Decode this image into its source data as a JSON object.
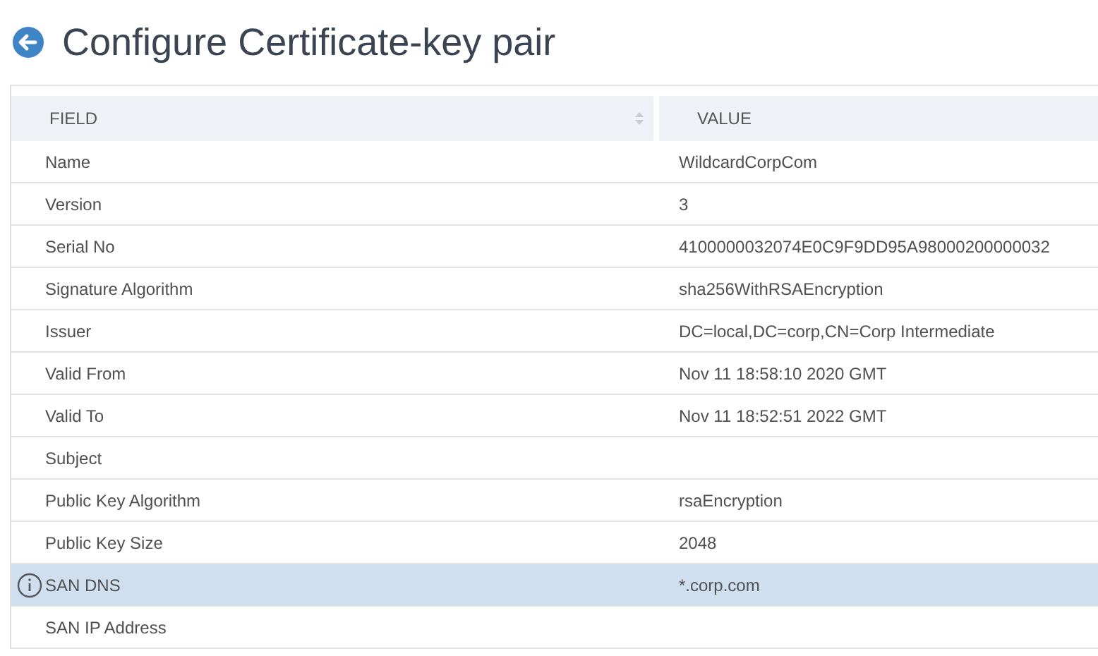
{
  "page": {
    "title": "Configure Certificate-key pair"
  },
  "table": {
    "columns": [
      {
        "label": "FIELD",
        "sortable": true
      },
      {
        "label": "VALUE",
        "sortable": false
      }
    ],
    "rows": [
      {
        "field": "Name",
        "value": "WildcardCorpCom",
        "selected": false
      },
      {
        "field": "Version",
        "value": "3",
        "selected": false
      },
      {
        "field": "Serial No",
        "value": "4100000032074E0C9F9DD95A98000200000032",
        "selected": false
      },
      {
        "field": "Signature Algorithm",
        "value": "sha256WithRSAEncryption",
        "selected": false
      },
      {
        "field": "Issuer",
        "value": "DC=local,DC=corp,CN=Corp Intermediate",
        "selected": false
      },
      {
        "field": "Valid From",
        "value": "Nov 11 18:58:10 2020 GMT",
        "selected": false
      },
      {
        "field": "Valid To",
        "value": "Nov 11 18:52:51 2022 GMT",
        "selected": false
      },
      {
        "field": "Subject",
        "selected": false
      },
      {
        "field": "Public Key Algorithm",
        "value": "rsaEncryption",
        "selected": false
      },
      {
        "field": "Public Key Size",
        "value": "2048",
        "selected": false
      },
      {
        "field": "SAN DNS",
        "value": "*.corp.com",
        "selected": true
      },
      {
        "field": "SAN IP Address",
        "selected": false
      }
    ]
  }
}
